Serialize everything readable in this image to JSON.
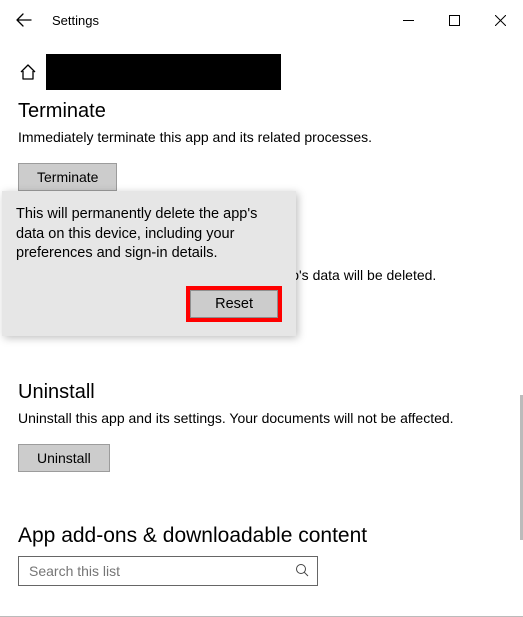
{
  "window": {
    "title": "Settings"
  },
  "terminate": {
    "heading": "Terminate",
    "desc": "Immediately terminate this app and its related processes.",
    "button": "Terminate"
  },
  "reset": {
    "underlying_text_fragment": "o's data will be deleted.",
    "button": "Reset"
  },
  "uninstall": {
    "heading": "Uninstall",
    "desc": "Uninstall this app and its settings. Your documents will not be affected.",
    "button": "Uninstall"
  },
  "addons": {
    "heading": "App add-ons & downloadable content",
    "search_placeholder": "Search this list"
  },
  "flyout": {
    "text": "This will permanently delete the app's data on this device, including your preferences and sign-in details.",
    "confirm": "Reset"
  }
}
